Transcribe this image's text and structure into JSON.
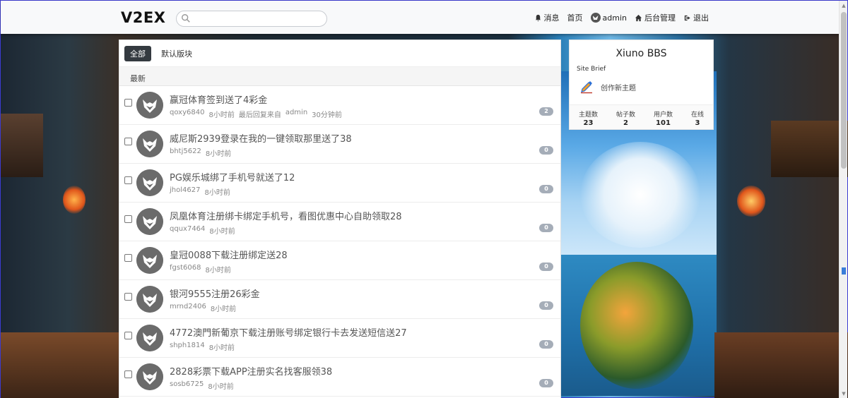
{
  "navbar": {
    "logo": "V2EX",
    "search_placeholder": "",
    "items": [
      {
        "icon": "bell-icon",
        "label": "消息"
      },
      {
        "icon": "",
        "label": "首页"
      },
      {
        "icon": "avatar",
        "label": "admin"
      },
      {
        "icon": "home-icon",
        "label": "后台管理"
      },
      {
        "icon": "logout-icon",
        "label": "退出"
      }
    ]
  },
  "tabs": [
    {
      "label": "全部",
      "active": true
    },
    {
      "label": "默认版块",
      "active": false
    }
  ],
  "section_header": "最新",
  "threads": [
    {
      "title": "赢冠体育签到送了4彩金",
      "author": "qoxy6840",
      "time": "8小时前",
      "last_reply_label": "最后回复来自",
      "last_reply_user": "admin",
      "last_reply_time": "30分钟前",
      "replies": "2"
    },
    {
      "title": "威尼斯2939登录在我的一键领取那里送了38",
      "author": "bhtj5622",
      "time": "8小时前",
      "replies": "0"
    },
    {
      "title": "PG娱乐城绑了手机号就送了12",
      "author": "jhol4627",
      "time": "8小时前",
      "replies": "0"
    },
    {
      "title": "凤凰体育注册绑卡绑定手机号，看图优惠中心自助领取28",
      "author": "qqux7464",
      "time": "8小时前",
      "replies": "0"
    },
    {
      "title": "皇冠0088下载注册绑定送28",
      "author": "fgst6068",
      "time": "8小时前",
      "replies": "0"
    },
    {
      "title": "银河9555注册26彩金",
      "author": "mrnd2406",
      "time": "8小时前",
      "replies": "0"
    },
    {
      "title": "4772澳門新葡京下载注册账号绑定银行卡去发送短信送27",
      "author": "shph1814",
      "time": "8小时前",
      "replies": "0"
    },
    {
      "title": "2828彩票下载APP注册实名找客服领38",
      "author": "sosb6725",
      "time": "8小时前",
      "replies": "0"
    }
  ],
  "sidebar": {
    "site_name": "Xiuno BBS",
    "brief": "Site Brief",
    "create_label": "创作新主题",
    "stats": [
      {
        "label": "主题数",
        "value": "23"
      },
      {
        "label": "帖子数",
        "value": "2"
      },
      {
        "label": "用户数",
        "value": "101"
      },
      {
        "label": "在线",
        "value": "3"
      }
    ]
  },
  "colors": {
    "navbar_bg": "#f8f9fa",
    "tab_active": "#343a40",
    "badge": "#a5adb8"
  }
}
